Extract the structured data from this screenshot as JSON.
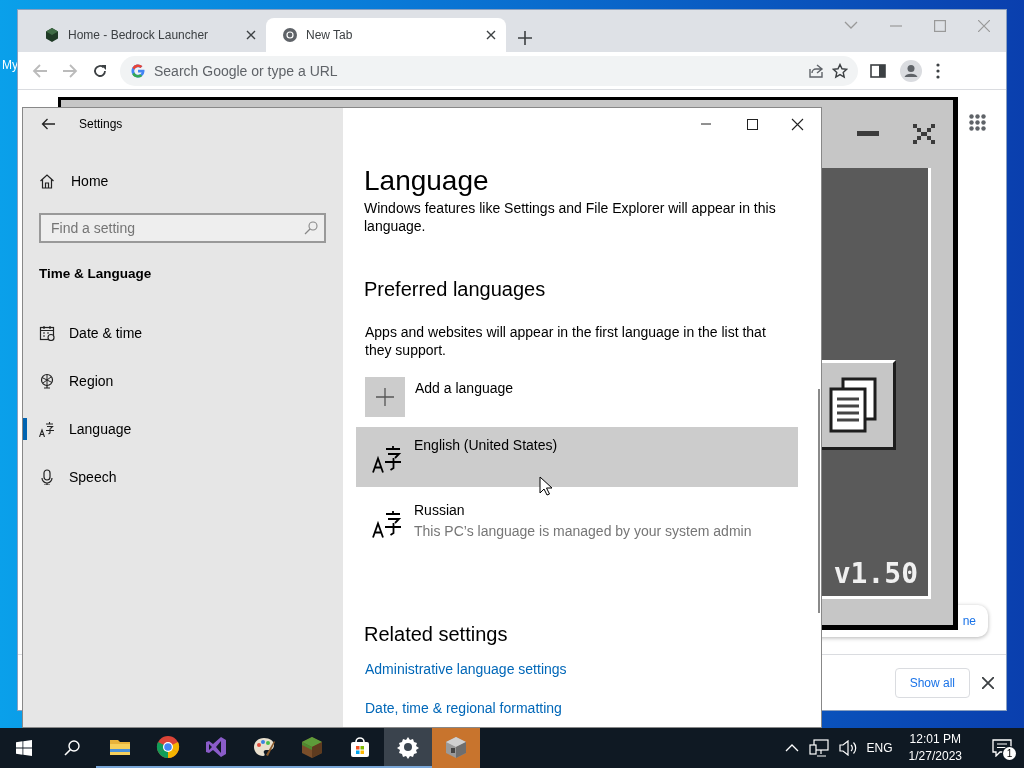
{
  "desktop": {
    "icon_label": "My"
  },
  "browser": {
    "tabs": [
      {
        "title": "Home - Bedrock Launcher",
        "kind": "cube",
        "selected": false
      },
      {
        "title": "New Tab",
        "kind": "chrome",
        "selected": true
      }
    ],
    "address_placeholder": "Search Google or type a URL",
    "launcher": {
      "version": "v1.50"
    },
    "popup_link": "ne",
    "download_bar": {
      "button": "Show all"
    }
  },
  "settings": {
    "title": "Settings",
    "home": "Home",
    "search_placeholder": "Find a setting",
    "section": "Time & Language",
    "nav": [
      {
        "label": "Date & time",
        "kind": "calendar",
        "selected": false
      },
      {
        "label": "Region",
        "kind": "globe",
        "selected": false
      },
      {
        "label": "Language",
        "kind": "language",
        "selected": true
      },
      {
        "label": "Speech",
        "kind": "microphone",
        "selected": false
      }
    ],
    "page": {
      "heading": "Language",
      "intro": "Windows features like Settings and File Explorer will appear in this language.",
      "preferred_heading": "Preferred languages",
      "preferred_text": "Apps and websites will appear in the first language in the list that they support.",
      "add_label": "Add a language",
      "languages": [
        {
          "name": "English (United States)",
          "selected": true
        },
        {
          "name": "Russian",
          "note": "This PC’s language is managed by your system admin",
          "selected": false
        }
      ],
      "related_heading": "Related settings",
      "related_links": [
        "Administrative language settings",
        "Date, time & regional formatting"
      ]
    }
  },
  "taskbar": {
    "apps": [
      {
        "kind": "explorer",
        "active": false,
        "flashing": false
      },
      {
        "kind": "chrome",
        "active": false,
        "flashing": false
      },
      {
        "kind": "studio",
        "active": false,
        "flashing": false
      },
      {
        "kind": "paint",
        "active": false,
        "flashing": false
      },
      {
        "kind": "minecraft",
        "active": false,
        "flashing": false
      },
      {
        "kind": "store",
        "active": false,
        "flashing": false
      },
      {
        "kind": "settings",
        "active": true,
        "flashing": false
      },
      {
        "kind": "launcher",
        "active": false,
        "flashing": true
      }
    ],
    "language": "ENG",
    "time": "12:01 PM",
    "date": "1/27/2023",
    "notifications": "1"
  }
}
